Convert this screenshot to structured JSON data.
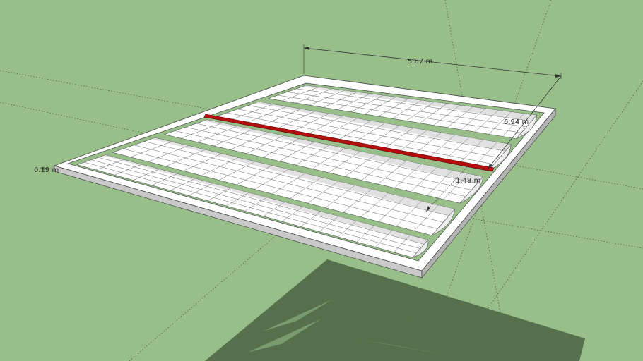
{
  "dimensions": {
    "width_label": "5.87 m",
    "depth_label": "6.94 m",
    "panel_label": "1.48 m",
    "frame_label": "0.19 m"
  },
  "colors": {
    "background": "#98bf8a",
    "frame_top": "#ffffff",
    "frame_side": "#c9c9c9",
    "shadow": "#566f4c",
    "highlight_bar": "#b30f0f",
    "grid_line": "#6c6c6c"
  }
}
